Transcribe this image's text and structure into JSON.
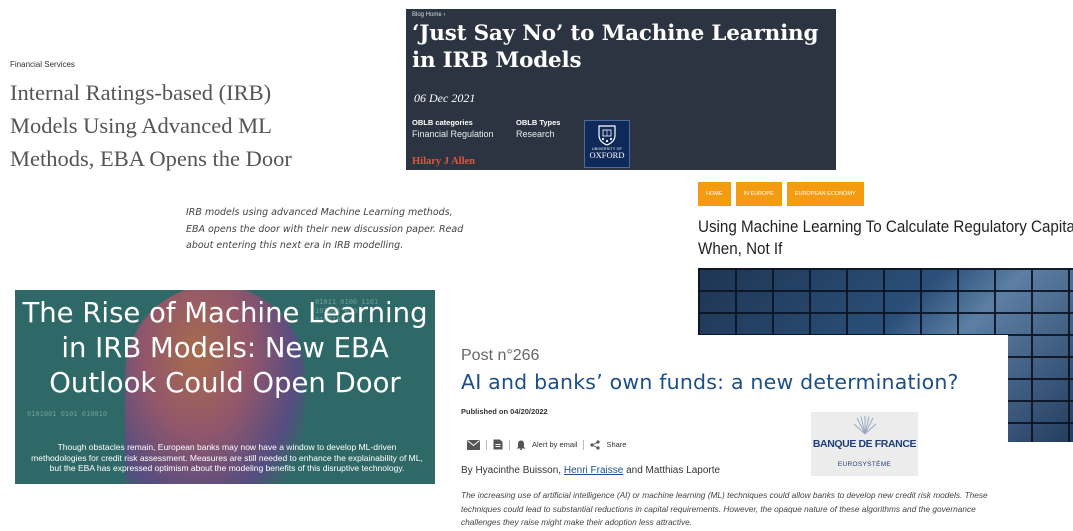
{
  "card1": {
    "category": "Financial Services",
    "title": "Internal Ratings-based (IRB) Models Using Advanced ML Methods, EBA Opens the Door"
  },
  "card2": {
    "breadcrumb": "Blog Home ›",
    "title": "‘Just Say No’ to Machine Learning in IRB Models",
    "date": "06 Dec 2021",
    "categories_label": "OBLB categories",
    "categories_value": "Financial Regulation",
    "types_label": "OBLB Types",
    "types_value": "Research",
    "author": "Hilary J Allen",
    "logo_line1": "UNIVERSITY OF",
    "logo_line2": "OXFORD"
  },
  "card3": {
    "blurb": "IRB models using advanced Machine Learning methods, EBA opens the door with their new discussion paper. Read about entering this next era in IRB modelling."
  },
  "card4": {
    "headline": "The Rise of Machine Learning in IRB Models: New EBA Outlook Could Open Door",
    "description": "Though obstacles remain, European banks may now have a window to develop ML-driven methodologies for credit risk assessment. Measures are still needed to enhance the explainability of ML, but the EBA has expressed optimism about the modeling benefits of this disruptive technology."
  },
  "card5": {
    "tags": [
      "HOME",
      "IN EUROPE",
      "EUROPEAN ECONOMY"
    ],
    "title_line1": "Using Machine Learning To Calculate Regulatory Capital:",
    "title_line2": "When, Not If"
  },
  "card6": {
    "post_number": "Post n°266",
    "title": "AI and banks’ own funds: a new determination?",
    "published": "Published on 04/20/2022",
    "alert_label": "Alert by email",
    "share_label": "Share",
    "authors_prefix": "By Hyacinthe Buisson,",
    "author_link": "Henri Fraisse",
    "authors_suffix": "and Matthias Laporte",
    "abstract": "The increasing use of artificial intelligence (AI) or machine learning (ML) techniques could allow banks to develop new credit risk models. These techniques could lead to substantial reductions in capital requirements. However, the opaque nature of these algorithms and the governance challenges they raise might make their adoption less attractive.",
    "logo_name": "BANQUE DE FRANCE",
    "logo_sub": "EUROSYSTÈME"
  }
}
